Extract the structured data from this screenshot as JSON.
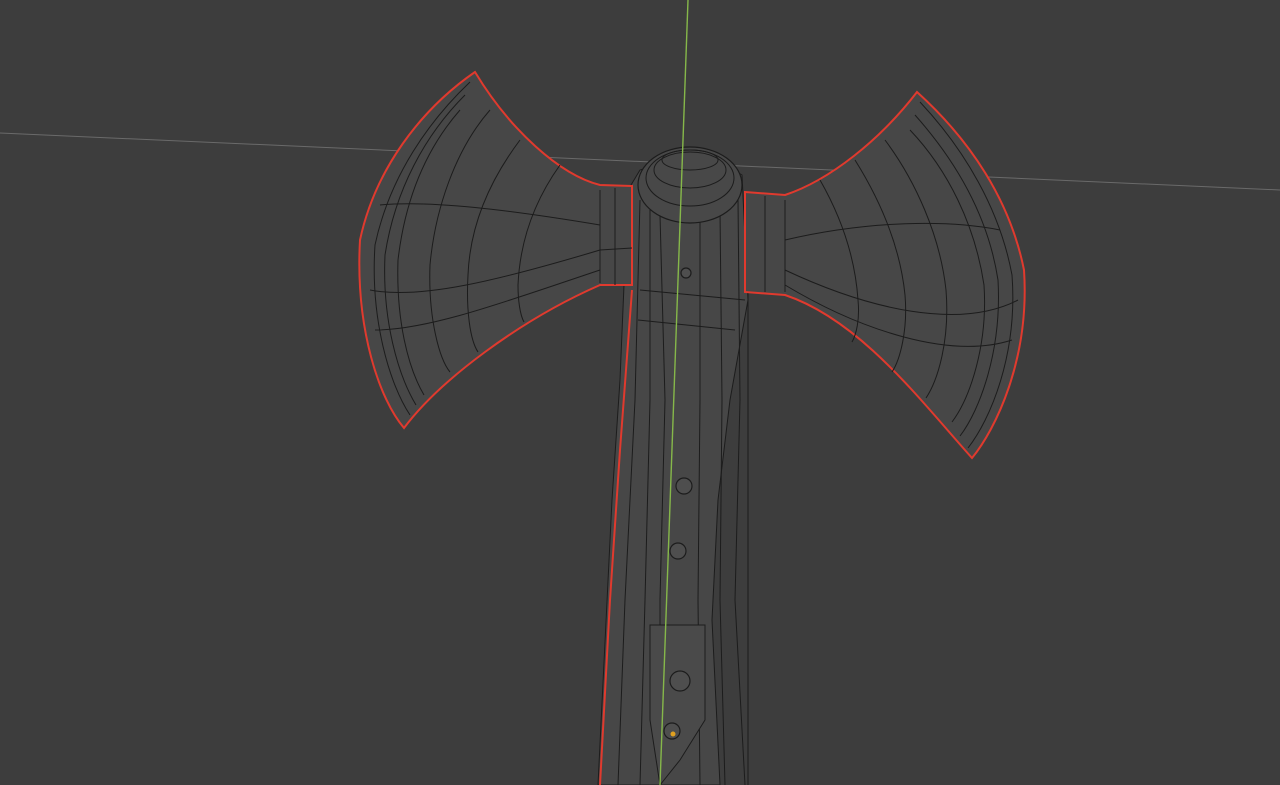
{
  "app": {
    "view": "3D viewport",
    "display_mode": "wireframe"
  },
  "scene": {
    "object": "double-bit-axe-mesh",
    "selection_outline": "selected"
  },
  "colors": {
    "background": "#3d3d3d",
    "wire": "#1c1c1c",
    "mesh_fill": "#474747",
    "selection_outline": "#e03a2e",
    "axis_y": "#86b84a",
    "axis_x_grid": "#6a6a6a",
    "origin_dot": "#e0a020"
  }
}
